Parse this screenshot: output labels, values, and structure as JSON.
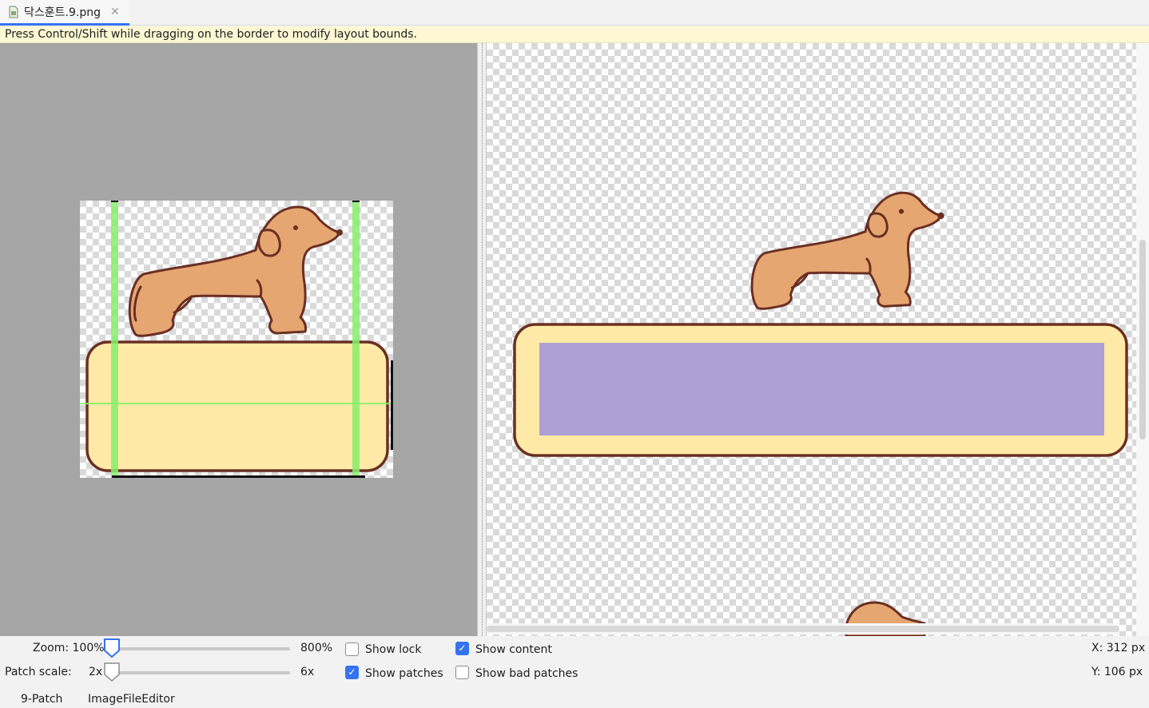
{
  "tab": {
    "label": "닥스훈트.9.png",
    "close": "✕",
    "accent": "#3574f0"
  },
  "hint": "Press Control/Shift while dragging on the border to modify layout bounds.",
  "zoom": {
    "label": "Zoom: 100%",
    "max": "800%",
    "value": 0.0
  },
  "patch_scale": {
    "label": "Patch scale:",
    "min": "2x",
    "max": "6x",
    "value": 0.0
  },
  "checkboxes": {
    "show_lock": {
      "label": "Show lock",
      "checked": false
    },
    "show_content": {
      "label": "Show content",
      "checked": true
    },
    "show_patches": {
      "label": "Show patches",
      "checked": true
    },
    "show_bad_patches": {
      "label": "Show bad patches",
      "checked": false
    }
  },
  "coords": {
    "x": "X: 312 px",
    "y": "Y: 106 px"
  },
  "bottom_tabs": [
    "9-Patch",
    "ImageFileEditor"
  ],
  "colors": {
    "patch_green": "#86ef6a",
    "content_purple": "#ae9fd4",
    "box_fill": "#feeaa6",
    "outline": "#6a2f23",
    "dog_fill": "#e6a672"
  }
}
